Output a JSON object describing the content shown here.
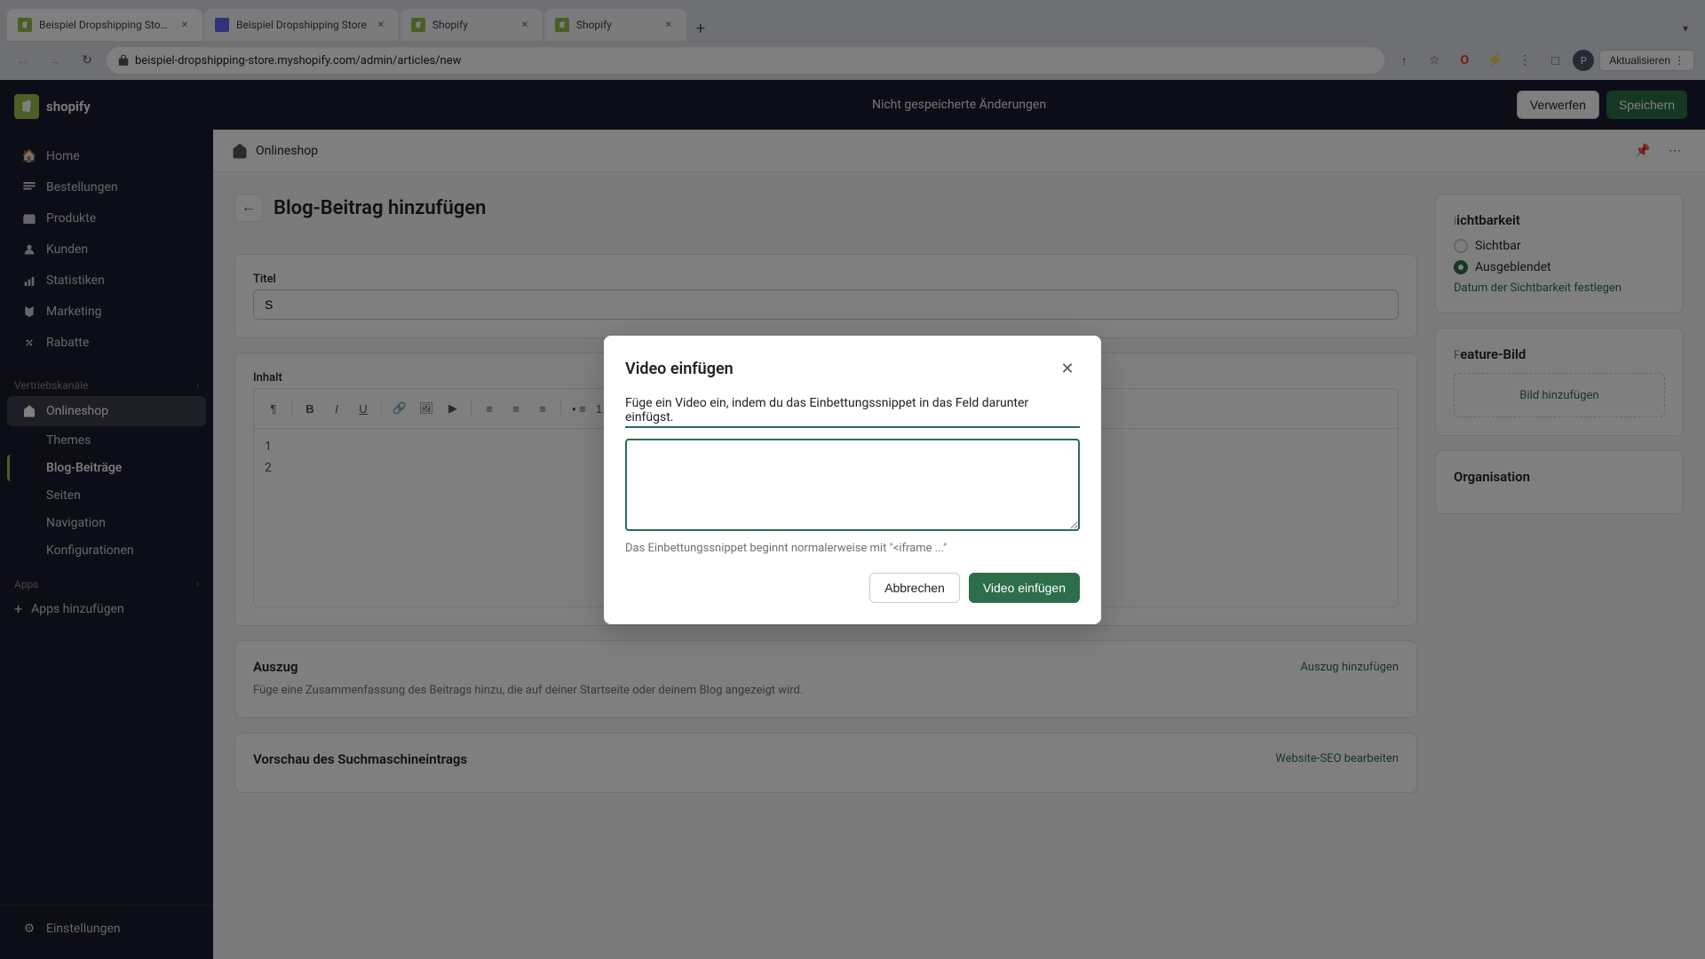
{
  "browser": {
    "tabs": [
      {
        "id": "tab1",
        "title": "Beispiel Dropshipping Store · E...",
        "favicon": "shopify",
        "active": true
      },
      {
        "id": "tab2",
        "title": "Beispiel Dropshipping Store",
        "favicon": "online",
        "active": false
      },
      {
        "id": "tab3",
        "title": "Shopify",
        "favicon": "shopify",
        "active": false
      },
      {
        "id": "tab4",
        "title": "Shopify",
        "favicon": "shopify",
        "active": false
      }
    ],
    "url": "beispiel-dropshipping-store.myshopify.com/admin/articles/new",
    "update_btn": "Aktualisieren"
  },
  "shopify": {
    "logo_text": "shopify",
    "top_bar_message": "Nicht gespeicherte Änderungen",
    "btn_discard": "Verwerfen",
    "btn_save": "Speichern"
  },
  "sidebar": {
    "nav_items": [
      {
        "id": "home",
        "label": "Home",
        "icon": "home"
      },
      {
        "id": "orders",
        "label": "Bestellungen",
        "icon": "orders"
      },
      {
        "id": "products",
        "label": "Produkte",
        "icon": "products"
      },
      {
        "id": "customers",
        "label": "Kunden",
        "icon": "customers"
      },
      {
        "id": "statistics",
        "label": "Statistiken",
        "icon": "stats"
      },
      {
        "id": "marketing",
        "label": "Marketing",
        "icon": "marketing"
      },
      {
        "id": "discounts",
        "label": "Rabatte",
        "icon": "discounts"
      }
    ],
    "sales_channels_label": "Vertriebskanäle",
    "online_shop_label": "Onlineshop",
    "sub_items": [
      {
        "id": "themes",
        "label": "Themes"
      },
      {
        "id": "blog-posts",
        "label": "Blog-Beiträge",
        "active": true
      },
      {
        "id": "pages",
        "label": "Seiten"
      },
      {
        "id": "navigation",
        "label": "Navigation"
      },
      {
        "id": "configurations",
        "label": "Konfigurationen"
      }
    ],
    "apps_label": "Apps",
    "apps_add": "Apps hinzufügen",
    "settings_label": "Einstellungen"
  },
  "breadcrumb": {
    "icon": "store",
    "text": "Onlineshop"
  },
  "page": {
    "back_label": "←",
    "title": "Blog-Beitrag hinzufügen",
    "title_label": "Titel",
    "title_placeholder": "S...",
    "content_label": "Inhalt",
    "excerpt_title": "Auszug",
    "excerpt_add_link": "Auszug hinzufügen",
    "excerpt_desc": "Füge eine Zusammenfassung des Beitrags hinzu, die auf deiner Startseite oder deinem Blog angezeigt wird.",
    "seo_title": "Vorschau des Suchmaschineintrags",
    "seo_edit_link": "Website-SEO bearbeiten"
  },
  "visibility": {
    "title": "ichtbarkeit",
    "option_visible": "Sichtbar",
    "option_hidden": "Ausgeblendet",
    "schedule_link": "Datum der Sichtbarkeit festlegen"
  },
  "feature_image": {
    "title": "eature-Bild",
    "add_btn": "Bild hinzufügen"
  },
  "organisation": {
    "title": "Organisation"
  },
  "modal": {
    "title": "Video einfügen",
    "description": "Füge ein Video ein, indem du das Einbettungssnippet in das Feld darunter einfügst.",
    "textarea_placeholder": "",
    "hint": "Das Einbettungssnippet beginnt normalerweise mit \"<iframe ...\"",
    "btn_cancel": "Abbrechen",
    "btn_insert": "Video einfügen"
  }
}
